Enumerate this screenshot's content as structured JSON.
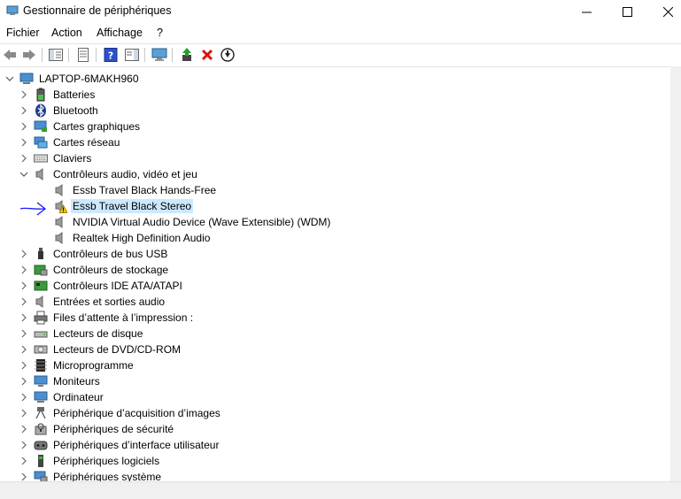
{
  "window": {
    "title": "Gestionnaire de périphériques"
  },
  "menu": [
    "Fichier",
    "Action",
    "Affichage",
    "?"
  ],
  "tree": {
    "root": "LAPTOP-6MAKH960",
    "categories": [
      {
        "label": "Batteries",
        "icon": "battery-icon"
      },
      {
        "label": "Bluetooth",
        "icon": "bluetooth-icon"
      },
      {
        "label": "Cartes graphiques",
        "icon": "display-adapter-icon"
      },
      {
        "label": "Cartes réseau",
        "icon": "network-adapter-icon"
      },
      {
        "label": "Claviers",
        "icon": "keyboard-icon"
      },
      {
        "label": "Contrôleurs audio, vidéo et jeu",
        "icon": "speaker-icon",
        "expanded": true,
        "children": [
          {
            "label": "Essb Travel Black Hands-Free",
            "icon": "speaker-icon"
          },
          {
            "label": "Essb Travel Black Stereo",
            "icon": "warning-speaker-icon",
            "selected": true
          },
          {
            "label": "NVIDIA Virtual Audio Device (Wave Extensible) (WDM)",
            "icon": "speaker-icon"
          },
          {
            "label": "Realtek High Definition Audio",
            "icon": "speaker-icon"
          }
        ]
      },
      {
        "label": "Contrôleurs de bus USB",
        "icon": "usb-icon"
      },
      {
        "label": "Contrôleurs de stockage",
        "icon": "storage-controller-icon"
      },
      {
        "label": "Contrôleurs IDE ATA/ATAPI",
        "icon": "ide-controller-icon"
      },
      {
        "label": "Entrées et sorties audio",
        "icon": "speaker-icon"
      },
      {
        "label": "Files d’attente à l’impression :",
        "icon": "printer-icon"
      },
      {
        "label": "Lecteurs de disque",
        "icon": "disk-drive-icon"
      },
      {
        "label": "Lecteurs de DVD/CD-ROM",
        "icon": "dvd-icon"
      },
      {
        "label": "Microprogramme",
        "icon": "firmware-icon"
      },
      {
        "label": "Moniteurs",
        "icon": "monitor-icon"
      },
      {
        "label": "Ordinateur",
        "icon": "computer-icon"
      },
      {
        "label": "Périphérique d’acquisition d’images",
        "icon": "camera-icon"
      },
      {
        "label": "Périphériques de sécurité",
        "icon": "security-icon"
      },
      {
        "label": "Périphériques d’interface utilisateur",
        "icon": "hid-icon"
      },
      {
        "label": "Périphériques logiciels",
        "icon": "software-device-icon"
      },
      {
        "label": "Périphériques système",
        "icon": "system-device-icon"
      }
    ]
  },
  "colors": {
    "selection": "#cce8ff",
    "annotation": "#1a1aff",
    "warning": "#f2c200",
    "delete": "#e01010"
  }
}
